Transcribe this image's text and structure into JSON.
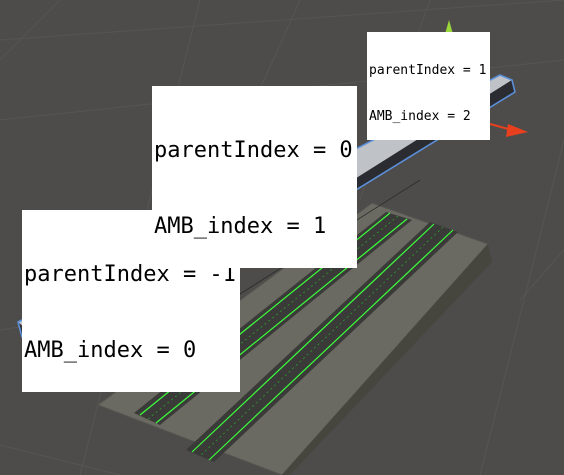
{
  "scene": {
    "colors": {
      "background": "#4d4c4b",
      "platform_top": "#c3c6ca",
      "platform_side": "#2a2c31",
      "selection_outline": "#5b8fd8",
      "ground": "#6b6b63",
      "track_ballast": "#3c3c3a",
      "track_wireframe": "#3cff3c",
      "gizmo_x": "#e8401e",
      "gizmo_y": "#9bd63a",
      "gizmo_z": "#4a7ce0"
    },
    "icons": {
      "move_gizmo": "move-gizmo-icon"
    }
  },
  "labels": [
    {
      "id": "a",
      "parent_index": "parentIndex = -1",
      "amb_index": "AMB_index = 0"
    },
    {
      "id": "b",
      "parent_index": "parentIndex = 0",
      "amb_index": "AMB_index = 1"
    },
    {
      "id": "c",
      "parent_index": "parentIndex = 1",
      "amb_index": "AMB_index = 2"
    }
  ]
}
